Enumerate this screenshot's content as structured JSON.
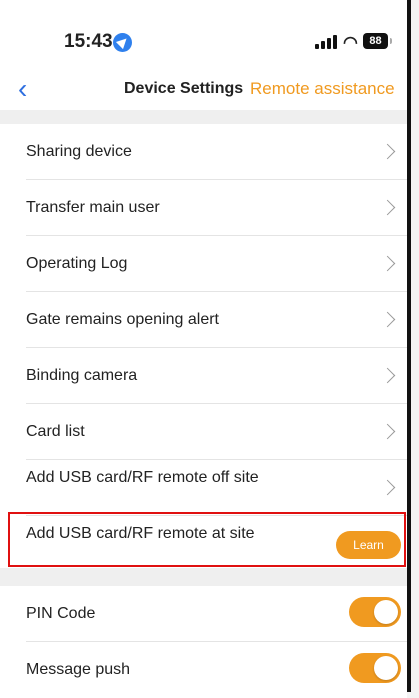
{
  "status_bar": {
    "time": "15:43",
    "battery": "88",
    "icons": [
      "location-arrow-icon",
      "cellular-signal-icon",
      "wifi-icon",
      "battery-icon"
    ]
  },
  "nav": {
    "title": "Device Settings",
    "right_link": "Remote assistance"
  },
  "settings": {
    "items": [
      {
        "label": "Sharing device"
      },
      {
        "label": "Transfer main user"
      },
      {
        "label": "Operating Log"
      },
      {
        "label": "Gate remains opening alert"
      },
      {
        "label": "Binding camera"
      },
      {
        "label": "Card list"
      },
      {
        "label": "Add USB card/RF remote off site"
      },
      {
        "label": "Add USB card/RF remote at site",
        "action": "Learn"
      }
    ]
  },
  "toggles": {
    "items": [
      {
        "label": "PIN Code",
        "state": "on"
      },
      {
        "label": "Message push",
        "state": "on"
      }
    ]
  },
  "colors": {
    "accent": "#f09a20",
    "back_arrow": "#2f6fe0",
    "highlight_box": "#e01010"
  }
}
